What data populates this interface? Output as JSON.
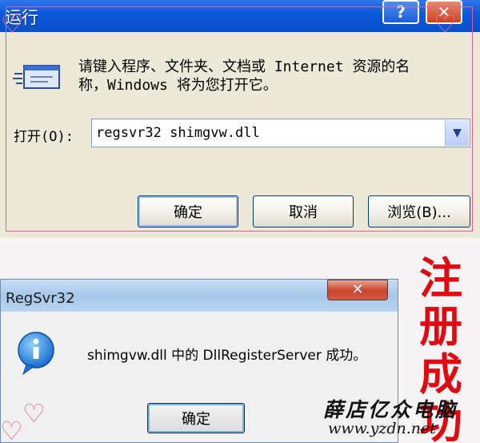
{
  "run_dialog": {
    "title": "运行",
    "description_line1": "请键入程序、文件夹、文档或 Internet 资源的名",
    "description_line2": "称，Windows 将为您打开它。",
    "open_label": "打开(O):",
    "open_value": "regsvr32 shimgvw.dll",
    "ok_label": "确定",
    "cancel_label": "取消",
    "browse_label": "浏览(B)..."
  },
  "regsvr_dialog": {
    "title": "RegSvr32",
    "message": "shimgvw.dll 中的 DllRegisterServer 成功。",
    "ok_label": "确定"
  },
  "overlay": {
    "success_text": "注册成功",
    "watermark_name": "薛店亿众电脑",
    "watermark_url": "www.yzdn.net"
  },
  "colors": {
    "xp_title_blue": "#0a57d8",
    "success_red": "#e00a10",
    "frame_pink": "#e35e9f"
  }
}
